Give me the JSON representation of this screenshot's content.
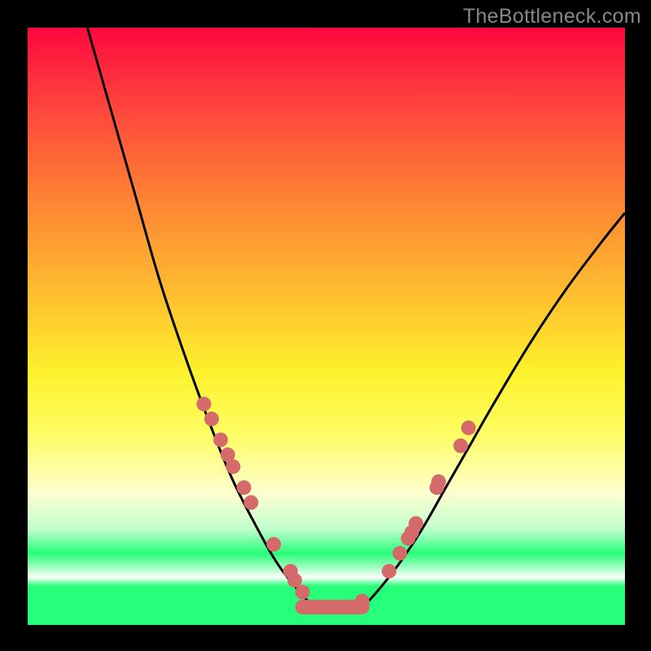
{
  "watermark": "TheBottleneck.com",
  "chart_data": {
    "type": "line",
    "title": "",
    "xlabel": "",
    "ylabel": "",
    "xlim": [
      0,
      100
    ],
    "ylim": [
      0,
      100
    ],
    "curve_left": {
      "x": [
        10,
        14,
        18,
        22,
        26,
        30,
        34,
        38,
        42,
        46,
        48
      ],
      "y": [
        100,
        86,
        72,
        58,
        46,
        35,
        25,
        17,
        10,
        5,
        3
      ]
    },
    "curve_right": {
      "x": [
        56,
        58,
        62,
        66,
        70,
        74,
        78,
        84,
        90,
        96,
        100
      ],
      "y": [
        3,
        5,
        10,
        16,
        23,
        30,
        37,
        47,
        56,
        64,
        69
      ]
    },
    "flat_segment": {
      "x": [
        46,
        56
      ],
      "y": [
        3,
        3
      ]
    },
    "markers_left": {
      "x": [
        29.5,
        30.8,
        32.3,
        33.5,
        34.4,
        36.2,
        37.4,
        41.2,
        44.0,
        44.7,
        46.0,
        48.0
      ],
      "y": [
        37,
        34.5,
        31,
        28.5,
        26.5,
        23,
        20.5,
        13.5,
        9,
        7.5,
        5.5,
        3
      ]
    },
    "markers_right": {
      "x": [
        54.5,
        56.0,
        60.5,
        62.3,
        63.7,
        64.3,
        65.0,
        68.5,
        68.8,
        72.5,
        73.8
      ],
      "y": [
        3,
        4,
        9,
        12,
        14.5,
        15.5,
        17,
        23,
        24,
        30,
        33
      ]
    },
    "colors": {
      "curve": "#000000",
      "marker_fill": "#d46a6a",
      "marker_stroke": "#d46a6a"
    }
  }
}
